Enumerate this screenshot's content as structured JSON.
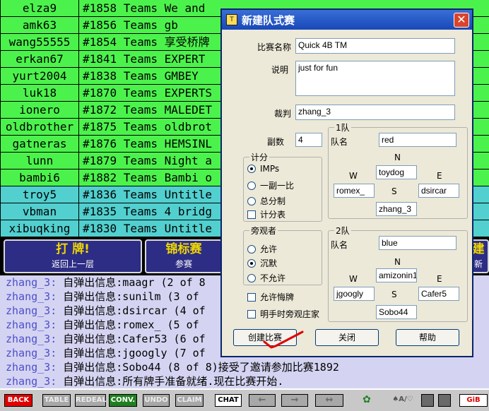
{
  "tables": [
    {
      "user": "elza9",
      "info": "#1858 Teams We and",
      "style": "green"
    },
    {
      "user": "amk63",
      "info": "#1856 Teams gb",
      "style": "green"
    },
    {
      "user": "wang55555",
      "info": "#1854 Teams 享受桥牌",
      "style": "green"
    },
    {
      "user": "erkan67",
      "info": "#1841 Teams EXPERT",
      "style": "green"
    },
    {
      "user": "yurt2004",
      "info": "#1838 Teams GMBEY",
      "style": "green"
    },
    {
      "user": "luk18",
      "info": "#1870 Teams EXPERTS",
      "style": "green"
    },
    {
      "user": "ionero",
      "info": "#1872 Teams MALEDET",
      "style": "green"
    },
    {
      "user": "oldbrother",
      "info": "#1875 Teams oldbrot",
      "style": "green"
    },
    {
      "user": "gatneras",
      "info": "#1876 Teams HEMSINL",
      "style": "green"
    },
    {
      "user": "lunn",
      "info": "#1879 Teams Night a",
      "style": "green"
    },
    {
      "user": "bambi6",
      "info": "#1882 Teams Bambi o",
      "style": "green"
    },
    {
      "user": "troy5",
      "info": "#1836 Teams Untitle",
      "style": "cyan"
    },
    {
      "user": "vbman",
      "info": "#1835 Teams 4 bridg",
      "style": "cyan"
    },
    {
      "user": "xibuqking",
      "info": "#1830 Teams Untitle",
      "style": "cyan"
    }
  ],
  "banner": {
    "play_title": "打 牌!",
    "play_sub": "返回上一层",
    "champ_title": "锦标赛",
    "champ_sub": "参赛",
    "right_title": "建",
    "right_sub": "新"
  },
  "chat": [
    {
      "who": "zhang_3:",
      "msg": " 自弹出信息:maagr (2 of 8"
    },
    {
      "who": "zhang_3:",
      "msg": " 自弹出信息:sunilm (3 of"
    },
    {
      "who": "zhang_3:",
      "msg": " 自弹出信息:dsircar (4 of"
    },
    {
      "who": "zhang_3:",
      "msg": " 自弹出信息:romex_ (5 of"
    },
    {
      "who": "zhang_3:",
      "msg": " 自弹出信息:Cafer53 (6 of"
    },
    {
      "who": "zhang_3:",
      "msg": " 自弹出信息:jgoogly (7 of"
    },
    {
      "who": "zhang_3:",
      "msg": " 自弹出信息:Sobo44 (8 of 8)接受了邀请参加比赛1892"
    },
    {
      "who": "zhang_3:",
      "msg": " 自弹出信息:所有牌手准备就绪.现在比赛开始."
    }
  ],
  "toolbar": {
    "back": "BACK",
    "table": "TABLE",
    "redeal": "REDEAL",
    "conv": "CONV.",
    "undo": "UNDO",
    "claim": "CLAIM",
    "chat": "CHAT",
    "arrow_left": "←",
    "arrow_right": "→",
    "arrow_lr": "↔",
    "bid_label": "♠A/♡",
    "gib": "GiB"
  },
  "dialog": {
    "title": "新建队式赛",
    "close_glyph": "✕",
    "app_icon": "T",
    "name_label": "比赛名称",
    "name_value": "Quick 4B TM",
    "desc_label": "说明",
    "desc_value": "just for fun",
    "director_label": "裁判",
    "director_value": "zhang_3",
    "boards_label": "副数",
    "boards_value": "4",
    "scoring": {
      "title": "计分",
      "options": [
        "IMPs",
        "一副一比",
        "总分制"
      ],
      "selected": 0,
      "scoresheet_label": "计分表"
    },
    "spectators": {
      "title": "旁观者",
      "options": [
        "允许",
        "沉默",
        "不允许"
      ],
      "selected": 1
    },
    "allow_undo_label": "允许悔牌",
    "dummy_label": "明手时旁观庄家",
    "team1": {
      "title": "1队",
      "name_label": "队名",
      "name": "red",
      "n_label": "N",
      "w_label": "W",
      "e_label": "E",
      "s_label": "S",
      "north": "toydog",
      "west": "romex_",
      "east": "dsircar",
      "south": "zhang_3"
    },
    "team2": {
      "title": "2队",
      "name_label": "队名",
      "name": "blue",
      "n_label": "N",
      "w_label": "W",
      "e_label": "E",
      "s_label": "S",
      "north": "amizonin1",
      "west": "jgoogly",
      "east": "Cafer5",
      "south": "Sobo44"
    },
    "create_label": "创建比赛",
    "close_label": "关闭",
    "help_label": "帮助"
  },
  "colors": {
    "row_green": "#4cf24c",
    "row_cyan": "#52cfcf",
    "chat_bg": "#d4d4f2",
    "chat_user": "#4d4dcc",
    "banner_btn": "#2d2d85",
    "banner_text": "#f0d700",
    "titlebar": "#1848b8",
    "handwritten_mark": "#e00000"
  }
}
